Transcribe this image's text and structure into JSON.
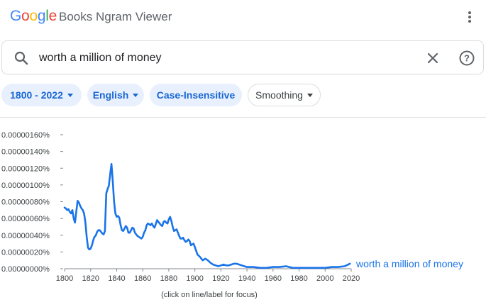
{
  "header": {
    "logo": {
      "letters": [
        "G",
        "o",
        "o",
        "g",
        "l",
        "e"
      ],
      "colors": [
        "#4285F4",
        "#EA4335",
        "#FBBC05",
        "#4285F4",
        "#34A853",
        "#EA4335"
      ]
    },
    "title": "Books Ngram Viewer",
    "menu_icon": "more-vert-icon"
  },
  "search": {
    "value": "worth a million of money",
    "search_icon": "search-icon",
    "clear_icon": "close-icon",
    "help_icon": "help-icon"
  },
  "filters": {
    "years": "1800 - 2022",
    "language": "English",
    "case": "Case-Insensitive",
    "smoothing": "Smoothing"
  },
  "colors": {
    "accent": "#1a73e8",
    "chip_bg": "#e8f0fe",
    "chip_text": "#1967d2"
  },
  "chart_data": {
    "type": "line",
    "title": "",
    "xlabel": "",
    "ylabel": "",
    "xlim": [
      1800,
      2022
    ],
    "ylim": [
      0,
      1.6e-06
    ],
    "y_ticks": [
      "0.00000000%",
      "0.00000020%",
      "0.00000040%",
      "0.00000060%",
      "0.00000080%",
      "0.00000100%",
      "0.00000120%",
      "0.00000140%",
      "0.00000160%"
    ],
    "x_ticks": [
      "1800",
      "1820",
      "1840",
      "1860",
      "1880",
      "1900",
      "1920",
      "1940",
      "1960",
      "1980",
      "2000",
      "2020"
    ],
    "grid": false,
    "series": [
      {
        "name": "worth a million of money",
        "color": "#1a73e8",
        "x": [
          1800,
          1801,
          1802,
          1803,
          1804,
          1805,
          1806,
          1807,
          1808,
          1809,
          1810,
          1811,
          1812,
          1813,
          1814,
          1815,
          1816,
          1817,
          1818,
          1819,
          1820,
          1821,
          1822,
          1823,
          1824,
          1825,
          1826,
          1827,
          1828,
          1829,
          1830,
          1831,
          1832,
          1833,
          1834,
          1835,
          1836,
          1837,
          1838,
          1839,
          1840,
          1841,
          1842,
          1843,
          1844,
          1845,
          1846,
          1847,
          1848,
          1849,
          1850,
          1851,
          1852,
          1853,
          1854,
          1855,
          1856,
          1857,
          1858,
          1859,
          1860,
          1861,
          1862,
          1863,
          1864,
          1865,
          1866,
          1867,
          1868,
          1869,
          1870,
          1871,
          1872,
          1873,
          1874,
          1875,
          1876,
          1877,
          1878,
          1879,
          1880,
          1881,
          1882,
          1883,
          1884,
          1885,
          1886,
          1887,
          1888,
          1889,
          1890,
          1891,
          1892,
          1893,
          1894,
          1895,
          1896,
          1897,
          1898,
          1899,
          1900,
          1902,
          1904,
          1906,
          1908,
          1910,
          1912,
          1914,
          1916,
          1918,
          1920,
          1922,
          1924,
          1926,
          1928,
          1930,
          1932,
          1934,
          1936,
          1938,
          1940,
          1945,
          1950,
          1955,
          1960,
          1965,
          1970,
          1975,
          1980,
          1985,
          1990,
          1995,
          2000,
          2005,
          2010,
          2015,
          2019
        ],
        "values": [
          7.3e-07,
          7.2e-07,
          7e-07,
          7.1e-07,
          6.8e-07,
          6.6e-07,
          7e-07,
          6e-07,
          5.5e-07,
          6.8e-07,
          8.1e-07,
          7.9e-07,
          7.5e-07,
          7.2e-07,
          7e-07,
          6.6e-07,
          5.5e-07,
          3.8e-07,
          2.5e-07,
          2.3e-07,
          2.4e-07,
          2.8e-07,
          3.4e-07,
          3.8e-07,
          4e-07,
          4.4e-07,
          4.6e-07,
          4.6e-07,
          4.4e-07,
          4.2e-07,
          4.1e-07,
          4.5e-07,
          9e-07,
          9.5e-07,
          9.9e-07,
          1.13e-06,
          1.25e-06,
          1.05e-06,
          8e-07,
          6.6e-07,
          6.2e-07,
          6.3e-07,
          6.1e-07,
          5.2e-07,
          4.6e-07,
          4.5e-07,
          4.8e-07,
          5.1e-07,
          4.9e-07,
          4.3e-07,
          4.3e-07,
          4.6e-07,
          4.9e-07,
          4.8e-07,
          4.3e-07,
          4.1e-07,
          3.9e-07,
          3.8e-07,
          3.7e-07,
          3.6e-07,
          3.8e-07,
          4.3e-07,
          4.6e-07,
          5.2e-07,
          5.4e-07,
          5.3e-07,
          5.2e-07,
          5.4e-07,
          5.1e-07,
          4.9e-07,
          5.3e-07,
          5.8e-07,
          5.6e-07,
          5.4e-07,
          5.2e-07,
          5.1e-07,
          5.6e-07,
          5.7e-07,
          5.5e-07,
          5.4e-07,
          5.9e-07,
          6.2e-07,
          5.7e-07,
          5e-07,
          4.5e-07,
          4.6e-07,
          4.7e-07,
          4.3e-07,
          3.9e-07,
          3.6e-07,
          3.6e-07,
          3.7e-07,
          3.4e-07,
          3.2e-07,
          3.3e-07,
          3.5e-07,
          3.3e-07,
          2.8e-07,
          2.9e-07,
          3e-07,
          2.6e-07,
          1.7e-07,
          1.4e-07,
          1e-07,
          1.2e-07,
          1e-07,
          7e-08,
          5e-08,
          4e-08,
          3e-08,
          4e-08,
          5e-08,
          4e-08,
          4e-08,
          5e-08,
          6e-08,
          6e-08,
          5e-08,
          4e-08,
          3e-08,
          2e-08,
          2e-08,
          1e-08,
          1e-08,
          2e-08,
          2e-08,
          3e-08,
          1e-08,
          1e-08,
          1e-08,
          1e-08,
          1e-08,
          1e-08,
          2e-08,
          2e-08,
          3e-08,
          6e-08
        ]
      }
    ]
  },
  "footnote": "(click on line/label for focus)"
}
